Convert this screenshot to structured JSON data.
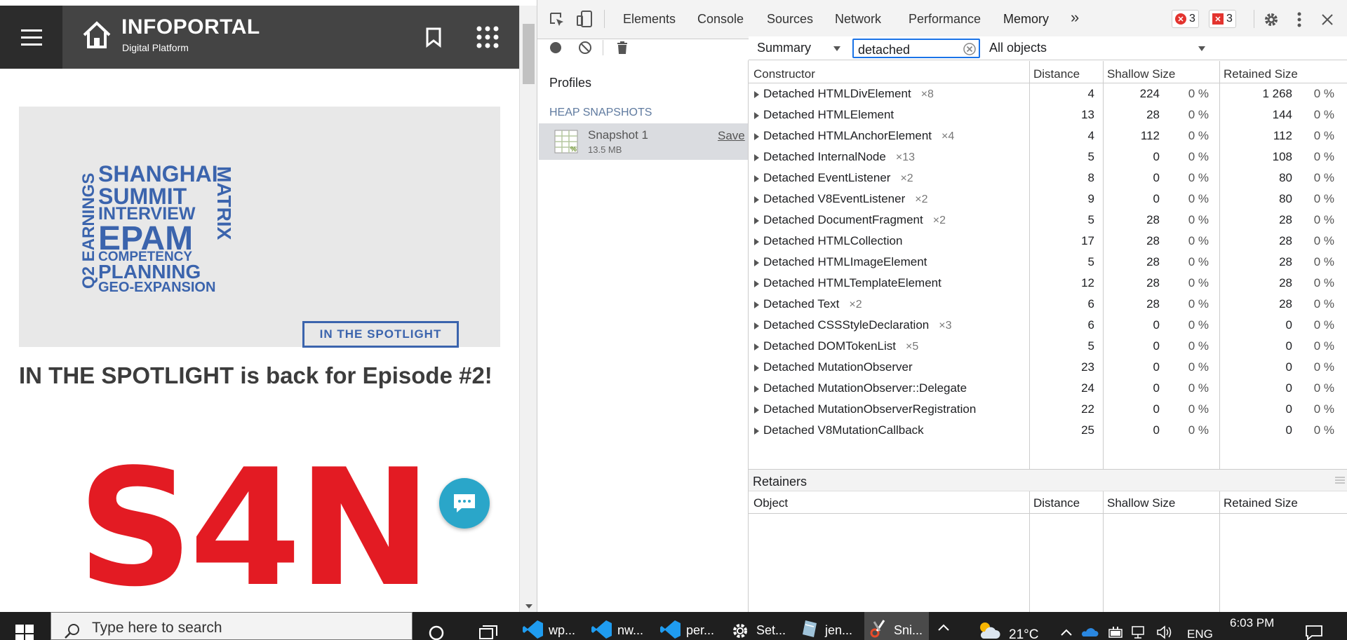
{
  "site": {
    "brand_name": "INFOPORTAL",
    "brand_sub": "Digital Platform"
  },
  "banner": {
    "words": [
      "SHANGHAI",
      "SUMMIT",
      "INTERVIEW",
      "EPAM",
      "COMPETENCY",
      "PLANNING",
      "GEO-EXPANSION"
    ],
    "vertical_left": "Q2 EARNINGS",
    "vertical_right": "MATRIX",
    "button": "IN THE SPOTLIGHT"
  },
  "article": {
    "title": "IN THE SPOTLIGHT is back for Episode #2!",
    "logo_text": "S4N"
  },
  "devtools": {
    "tabs": [
      "Elements",
      "Console",
      "Sources",
      "Network",
      "Performance",
      "Memory"
    ],
    "active_tab": "Memory",
    "more_tabs": "»",
    "error_count": "3",
    "issue_count": "3",
    "sidebar": {
      "profiles_label": "Profiles",
      "section": "HEAP SNAPSHOTS",
      "snapshot_name": "Snapshot 1",
      "snapshot_size": "13.5 MB",
      "save": "Save"
    },
    "filter": {
      "view": "Summary",
      "search_value": "detached",
      "objects": "All objects"
    },
    "columns": [
      "Constructor",
      "Distance",
      "Shallow Size",
      "Retained Size"
    ],
    "rows": [
      {
        "name": "Detached HTMLDivElement",
        "count": "×8",
        "distance": "4",
        "shallow": "224",
        "shallow_pct": "0 %",
        "retained": "1 268",
        "retained_pct": "0 %"
      },
      {
        "name": "Detached HTMLElement",
        "count": "",
        "distance": "13",
        "shallow": "28",
        "shallow_pct": "0 %",
        "retained": "144",
        "retained_pct": "0 %"
      },
      {
        "name": "Detached HTMLAnchorElement",
        "count": "×4",
        "distance": "4",
        "shallow": "112",
        "shallow_pct": "0 %",
        "retained": "112",
        "retained_pct": "0 %"
      },
      {
        "name": "Detached InternalNode",
        "count": "×13",
        "distance": "5",
        "shallow": "0",
        "shallow_pct": "0 %",
        "retained": "108",
        "retained_pct": "0 %"
      },
      {
        "name": "Detached EventListener",
        "count": "×2",
        "distance": "8",
        "shallow": "0",
        "shallow_pct": "0 %",
        "retained": "80",
        "retained_pct": "0 %"
      },
      {
        "name": "Detached V8EventListener",
        "count": "×2",
        "distance": "9",
        "shallow": "0",
        "shallow_pct": "0 %",
        "retained": "80",
        "retained_pct": "0 %"
      },
      {
        "name": "Detached DocumentFragment",
        "count": "×2",
        "distance": "5",
        "shallow": "28",
        "shallow_pct": "0 %",
        "retained": "28",
        "retained_pct": "0 %"
      },
      {
        "name": "Detached HTMLCollection",
        "count": "",
        "distance": "17",
        "shallow": "28",
        "shallow_pct": "0 %",
        "retained": "28",
        "retained_pct": "0 %"
      },
      {
        "name": "Detached HTMLImageElement",
        "count": "",
        "distance": "5",
        "shallow": "28",
        "shallow_pct": "0 %",
        "retained": "28",
        "retained_pct": "0 %"
      },
      {
        "name": "Detached HTMLTemplateElement",
        "count": "",
        "distance": "12",
        "shallow": "28",
        "shallow_pct": "0 %",
        "retained": "28",
        "retained_pct": "0 %"
      },
      {
        "name": "Detached Text",
        "count": "×2",
        "distance": "6",
        "shallow": "28",
        "shallow_pct": "0 %",
        "retained": "28",
        "retained_pct": "0 %"
      },
      {
        "name": "Detached CSSStyleDeclaration",
        "count": "×3",
        "distance": "6",
        "shallow": "0",
        "shallow_pct": "0 %",
        "retained": "0",
        "retained_pct": "0 %"
      },
      {
        "name": "Detached DOMTokenList",
        "count": "×5",
        "distance": "5",
        "shallow": "0",
        "shallow_pct": "0 %",
        "retained": "0",
        "retained_pct": "0 %"
      },
      {
        "name": "Detached MutationObserver",
        "count": "",
        "distance": "23",
        "shallow": "0",
        "shallow_pct": "0 %",
        "retained": "0",
        "retained_pct": "0 %"
      },
      {
        "name": "Detached MutationObserver::Delegate",
        "count": "",
        "distance": "24",
        "shallow": "0",
        "shallow_pct": "0 %",
        "retained": "0",
        "retained_pct": "0 %"
      },
      {
        "name": "Detached MutationObserverRegistration",
        "count": "",
        "distance": "22",
        "shallow": "0",
        "shallow_pct": "0 %",
        "retained": "0",
        "retained_pct": "0 %"
      },
      {
        "name": "Detached V8MutationCallback",
        "count": "",
        "distance": "25",
        "shallow": "0",
        "shallow_pct": "0 %",
        "retained": "0",
        "retained_pct": "0 %"
      }
    ],
    "retainers": {
      "title": "Retainers",
      "columns": [
        "Object",
        "Distance",
        "Shallow Size",
        "Retained Size"
      ]
    }
  },
  "taskbar": {
    "search_placeholder": "Type here to search",
    "apps": [
      "wp...",
      "nw...",
      "per...",
      "Set...",
      "jen...",
      "Sni..."
    ],
    "temperature": "21°C",
    "language": "ENG",
    "time": "6:03 PM"
  },
  "colors": {
    "accent": "#1a73e8",
    "banner_blue": "#3b64ad",
    "logo_red": "#e31b23",
    "chat": "#2aa6c9",
    "error": "#e3342f"
  }
}
